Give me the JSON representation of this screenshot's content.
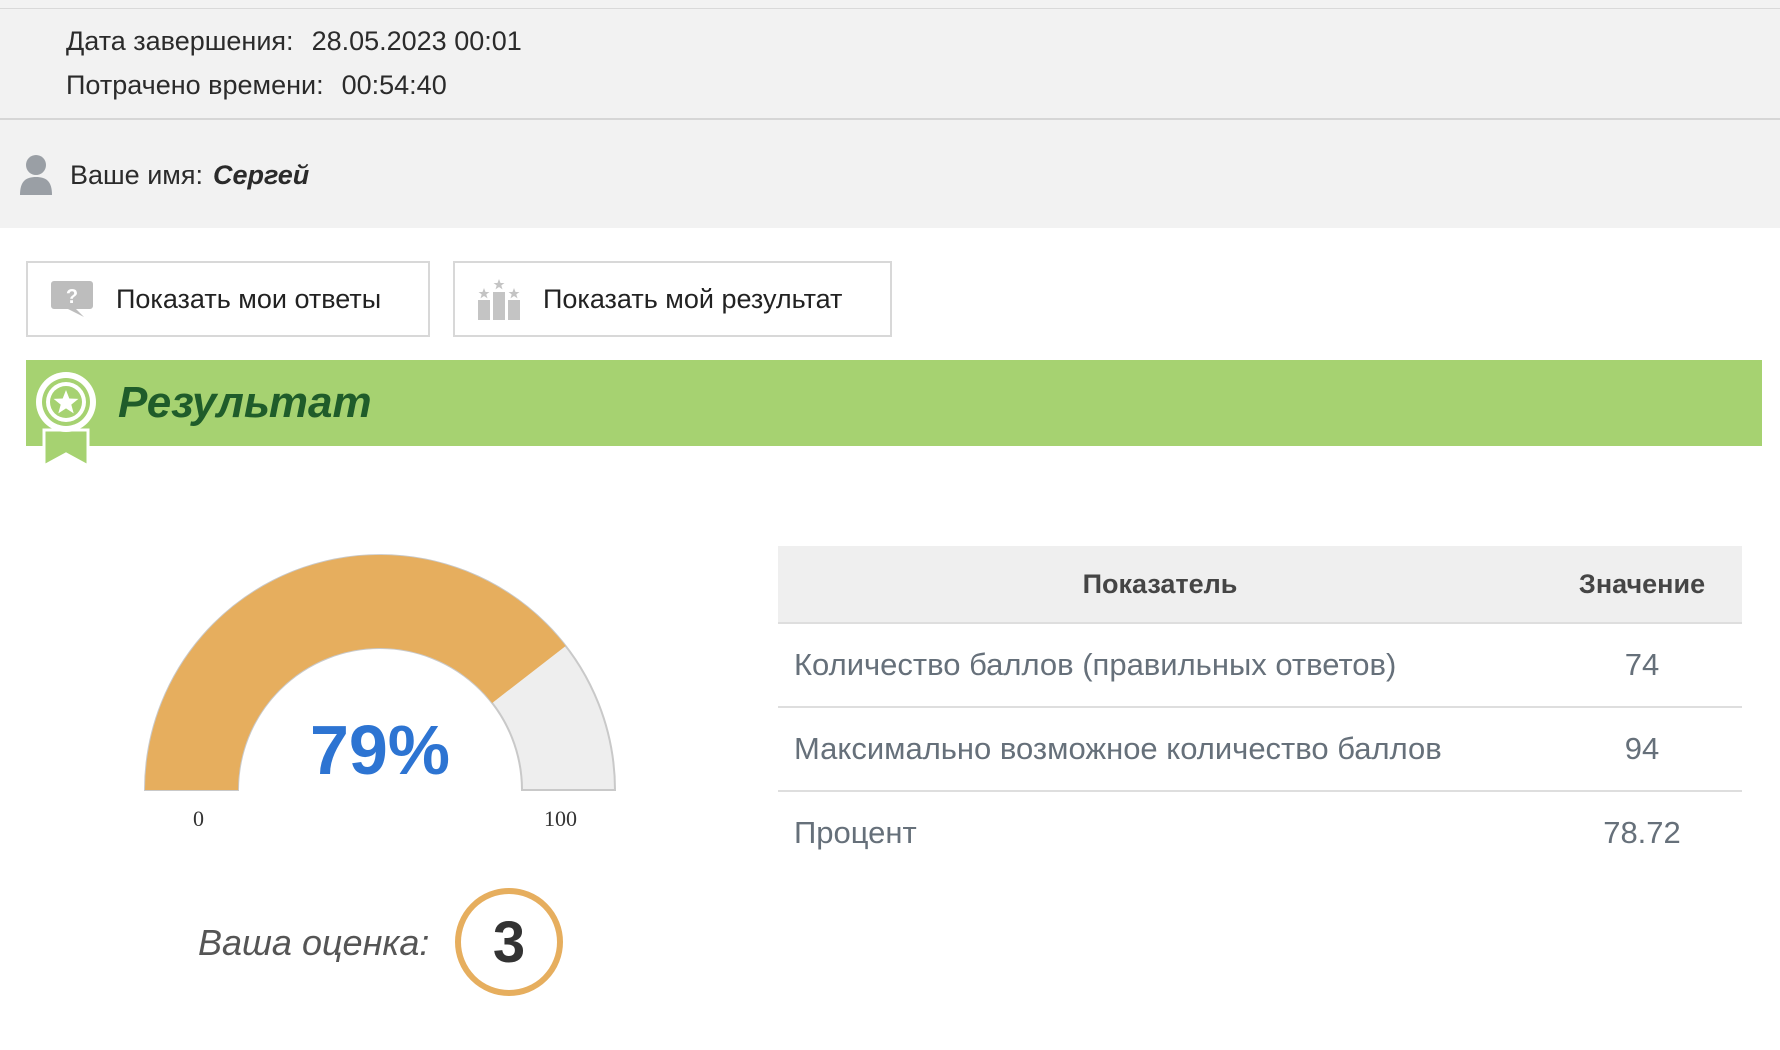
{
  "info": {
    "finish_label": "Дата завершения:",
    "finish_value": "28.05.2023 00:01",
    "spent_label": "Потрачено времени:",
    "spent_value": "00:54:40"
  },
  "user": {
    "label": "Ваше имя:",
    "name": "Сергей",
    "icon": "user-icon"
  },
  "buttons": {
    "show_answers": "Показать мои ответы",
    "show_answers_icon": "question-bubble-icon",
    "show_result": "Показать мой результат",
    "show_result_icon": "podium-icon"
  },
  "banner": {
    "title": "Результат",
    "icon": "award-ribbon-icon",
    "color": "#a6d271",
    "title_color": "#1f5c2a"
  },
  "gauge": {
    "value_text": "79%",
    "fraction": 0.79,
    "min_label": "0",
    "max_label": "100",
    "fill_color": "#e6ae5e",
    "empty_color": "#eeeeee"
  },
  "grade": {
    "label": "Ваша оценка:",
    "value": "3",
    "ring_color": "#e6ae5e"
  },
  "table": {
    "headers": [
      "Показатель",
      "Значение"
    ],
    "rows": [
      {
        "name": "Количество баллов (правильных ответов)",
        "value": "74"
      },
      {
        "name": "Максимально возможное количество баллов",
        "value": "94"
      },
      {
        "name": "Процент",
        "value": "78.72"
      }
    ]
  }
}
